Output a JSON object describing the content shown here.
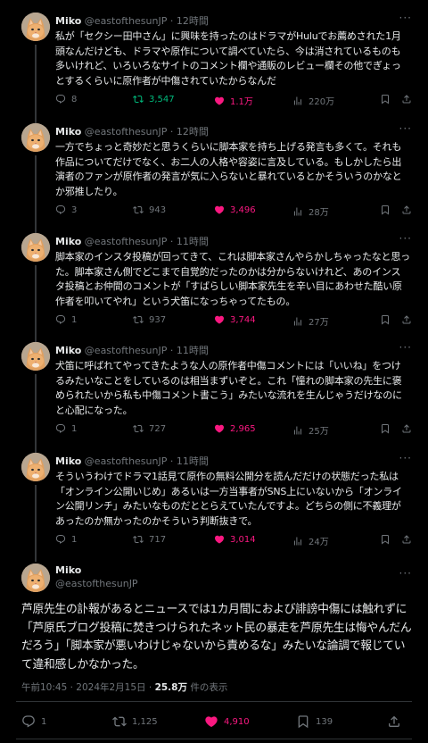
{
  "replies": [
    {
      "name": "Miko",
      "handle": "@eastofthesunJP",
      "time": "12時間",
      "text": "私が「セクシー田中さん」に興味を持ったのはドラマがHuluでお薦めされた1月頭なんだけども、ドラマや原作について調べていたら、今は消されているものも多いけれど、いろいろなサイトのコメント欄や通販のレビュー欄その他でぎょっとするくらいに原作者が中傷されていたからなんだ",
      "replies": "8",
      "retweets": "3,547",
      "likes": "1.1万",
      "views": "220万",
      "retweeted": true
    },
    {
      "name": "Miko",
      "handle": "@eastofthesunJP",
      "time": "12時間",
      "text": "一方でちょっと奇妙だと思うくらいに脚本家を持ち上げる発言も多くて。それも作品についてだけでなく、お二人の人格や容姿に言及している。もしかしたら出演者のファンが原作者の発言が気に入らないと暴れているとかそういうのかなとか邪推したり。",
      "replies": "3",
      "retweets": "943",
      "likes": "3,496",
      "views": "28万",
      "retweeted": false
    },
    {
      "name": "Miko",
      "handle": "@eastofthesunJP",
      "time": "11時間",
      "text": "脚本家のインスタ投稿が回ってきて、これは脚本家さんやらかしちゃったなと思った。脚本家さん側でどこまで自覚的だったのかは分からないけれど、あのインスタ投稿とお仲間のコメントが「すばらしい脚本家先生を辛い目にあわせた酷い原作者を叩いてやれ」という犬笛になっちゃってたもの。",
      "replies": "1",
      "retweets": "937",
      "likes": "3,744",
      "views": "27万",
      "retweeted": false
    },
    {
      "name": "Miko",
      "handle": "@eastofthesunJP",
      "time": "11時間",
      "text": "犬笛に呼ばれてやってきたような人の原作者中傷コメントには「いいね」をつけるみたいなことをしているのは相当まずいぞと。これ「憧れの脚本家の先生に褒められたいから私も中傷コメント書こう」みたいな流れを生んじゃうだけなのにと心配になった。",
      "replies": "1",
      "retweets": "727",
      "likes": "2,965",
      "views": "25万",
      "retweeted": false
    },
    {
      "name": "Miko",
      "handle": "@eastofthesunJP",
      "time": "11時間",
      "text": "そういうわけでドラマ1話見て原作の無料公開分を読んだだけの状態だった私は「オンライン公開いじめ」あるいは一方当事者がSNS上にいないから「オンライン公開リンチ」みたいなものだととらえていたんですよ。どちらの側に不義理があったのか無かったのかそういう判断抜きで。",
      "replies": "1",
      "retweets": "717",
      "likes": "3,014",
      "views": "24万",
      "retweeted": false
    }
  ],
  "main": {
    "name": "Miko",
    "handle": "@eastofthesunJP",
    "text": "芦原先生の訃報があるとニュースでは1カ月間におよび誹謗中傷には触れずに「芦原氏ブログ投稿に焚きつけられたネット民の暴走を芦原先生は悔やんだんだろう」「脚本家が悪いわけじゃないから責めるな」みたいな論調で報じていて違和感しかなかった。",
    "timestamp": "午前10:45 · 2024年2月15日 · ",
    "views_count": "25.8万",
    "views_label": " 件の表示",
    "replies": "1",
    "retweets": "1,125",
    "likes": "4,910",
    "bookmarks": "139"
  },
  "icons": [
    "avatar-cat",
    "reply-icon",
    "retweet-icon",
    "heart-icon",
    "views-icon",
    "bookmark-icon",
    "share-icon",
    "more-icon"
  ],
  "colors": {
    "background": "#000000",
    "text": "#e7e9ea",
    "muted": "#71767b",
    "retweet": "#00ba7c",
    "like": "#f91880"
  }
}
